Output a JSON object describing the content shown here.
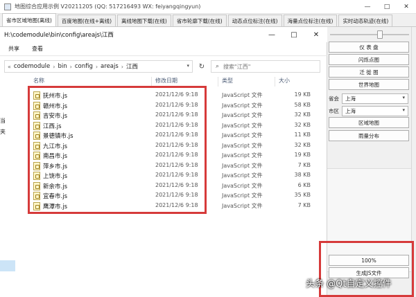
{
  "window": {
    "title": "地图综合应用示例 V20211205 (QQ: 517216493 WX: feiyangqingyun)",
    "controls": [
      "—",
      "□",
      "✕"
    ]
  },
  "tabs": [
    {
      "label": "省市区域地图(离线)",
      "active": true
    },
    {
      "label": "百度地图(在线+离线)",
      "active": false
    },
    {
      "label": "离线地图下载(在线)",
      "active": false
    },
    {
      "label": "省市轮廓下载(在线)",
      "active": false
    },
    {
      "label": "动态点位标注(在线)",
      "active": false
    },
    {
      "label": "海量点位标注(在线)",
      "active": false
    },
    {
      "label": "实时动态轨迹(在线)",
      "active": false
    }
  ],
  "explorer": {
    "title": "H:\\codemodule\\bin\\config\\areajs\\江西",
    "controls": [
      "—",
      "□",
      "✕"
    ],
    "ribbon": [
      "共享",
      "查看"
    ],
    "breadcrumb": [
      "codemodule",
      "bin",
      "config",
      "areajs",
      "江西"
    ],
    "search_placeholder": "搜索\"江西\"",
    "nav_items": [
      "当",
      "夹"
    ],
    "columns": {
      "name": "名称",
      "date": "修改日期",
      "type": "类型",
      "size": "大小"
    },
    "files": [
      {
        "name": "抚州市.js",
        "date": "2021/12/6 9:18",
        "type": "JavaScript 文件",
        "size": "19 KB"
      },
      {
        "name": "赣州市.js",
        "date": "2021/12/6 9:18",
        "type": "JavaScript 文件",
        "size": "58 KB"
      },
      {
        "name": "吉安市.js",
        "date": "2021/12/6 9:18",
        "type": "JavaScript 文件",
        "size": "32 KB"
      },
      {
        "name": "江西.js",
        "date": "2021/12/6 9:18",
        "type": "JavaScript 文件",
        "size": "32 KB"
      },
      {
        "name": "景德镇市.js",
        "date": "2021/12/6 9:18",
        "type": "JavaScript 文件",
        "size": "11 KB"
      },
      {
        "name": "九江市.js",
        "date": "2021/12/6 9:18",
        "type": "JavaScript 文件",
        "size": "32 KB"
      },
      {
        "name": "南昌市.js",
        "date": "2021/12/6 9:18",
        "type": "JavaScript 文件",
        "size": "19 KB"
      },
      {
        "name": "萍乡市.js",
        "date": "2021/12/6 9:18",
        "type": "JavaScript 文件",
        "size": "7 KB"
      },
      {
        "name": "上饶市.js",
        "date": "2021/12/6 9:18",
        "type": "JavaScript 文件",
        "size": "38 KB"
      },
      {
        "name": "新余市.js",
        "date": "2021/12/6 9:18",
        "type": "JavaScript 文件",
        "size": "6 KB"
      },
      {
        "name": "宜春市.js",
        "date": "2021/12/6 9:18",
        "type": "JavaScript 文件",
        "size": "35 KB"
      },
      {
        "name": "鹰潭市.js",
        "date": "2021/12/6 9:18",
        "type": "JavaScript 文件",
        "size": "7 KB"
      }
    ]
  },
  "panel": {
    "buttons_top": [
      "仪 表 盘",
      "闪烁点图",
      "迁 徙 图",
      "世界地图"
    ],
    "province_label": "省会",
    "province_value": "上海",
    "city_label": "市区",
    "city_value": "上海",
    "buttons_mid": [
      "区域地图",
      "雨量分布"
    ],
    "zoom_button": "100%",
    "save_button": "生成JS文件"
  },
  "watermark": "头条 @Qt自定义控件",
  "colors": {
    "highlight": "#d63a3a",
    "tab_active": "#ffffff",
    "panel_bg": "#f0f0f0"
  }
}
